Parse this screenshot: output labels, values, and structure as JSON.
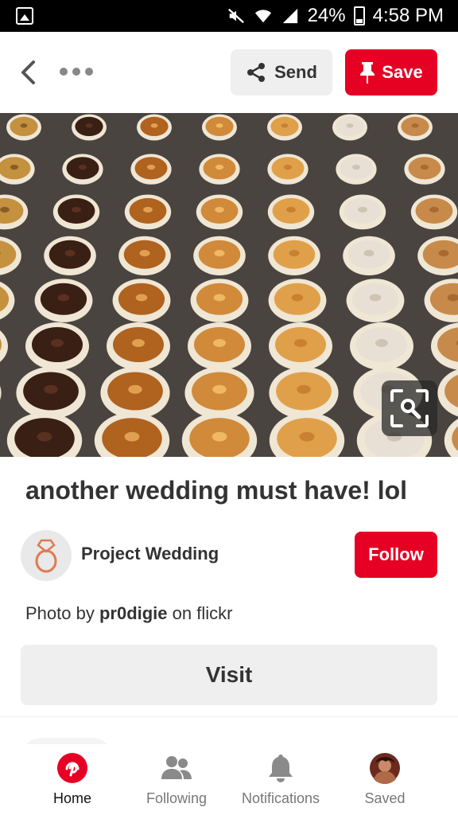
{
  "status_bar": {
    "battery": "24%",
    "time": "4:58 PM"
  },
  "toolbar": {
    "send_label": "Send",
    "save_label": "Save"
  },
  "pin": {
    "title": "another wedding must have! lol",
    "board_name": "Project Wedding",
    "follow_label": "Follow",
    "credit_prefix": "Photo by ",
    "credit_user": "pr0digie",
    "credit_suffix": " on flickr",
    "visit_label": "Visit"
  },
  "bottom_nav": {
    "items": [
      {
        "label": "Home",
        "icon": "pinterest-logo-icon",
        "active": true
      },
      {
        "label": "Following",
        "icon": "people-icon",
        "active": false
      },
      {
        "label": "Notifications",
        "icon": "bell-icon",
        "active": false
      },
      {
        "label": "Saved",
        "icon": "profile-avatar-icon",
        "active": false
      }
    ]
  },
  "colors": {
    "brand_red": "#e60023",
    "button_gray": "#efefef",
    "text": "#333333"
  }
}
